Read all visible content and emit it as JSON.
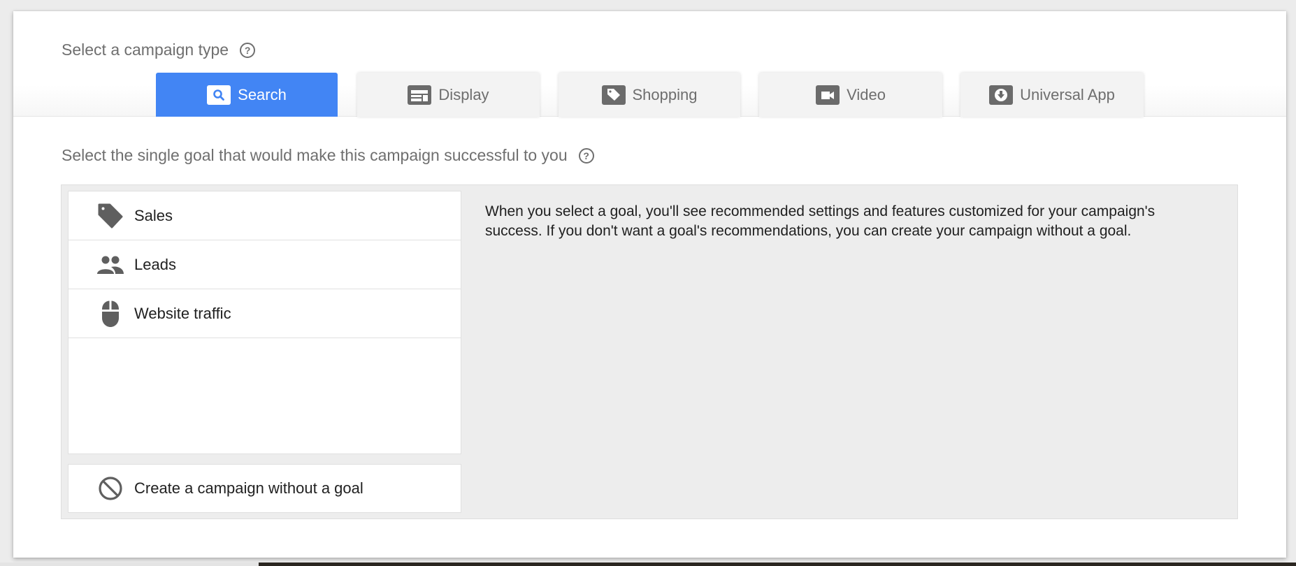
{
  "campaign_type": {
    "title": "Select a campaign type",
    "help_icon": "help-circle-icon",
    "tabs": [
      {
        "label": "Search",
        "icon": "search-icon",
        "active": true
      },
      {
        "label": "Display",
        "icon": "display-layout-icon",
        "active": false
      },
      {
        "label": "Shopping",
        "icon": "tag-icon",
        "active": false
      },
      {
        "label": "Video",
        "icon": "video-camera-icon",
        "active": false
      },
      {
        "label": "Universal App",
        "icon": "download-icon",
        "active": false
      }
    ],
    "active_color": "#4285f4"
  },
  "goal": {
    "title": "Select the single goal that would make this campaign successful to you",
    "help_icon": "help-circle-icon",
    "options": [
      {
        "label": "Sales",
        "icon": "tag-icon"
      },
      {
        "label": "Leads",
        "icon": "people-icon"
      },
      {
        "label": "Website traffic",
        "icon": "mouse-icon"
      }
    ],
    "no_goal": {
      "label": "Create a campaign without a goal",
      "icon": "block-icon"
    },
    "description": "When you select a goal, you'll see recommended settings and features customized for your campaign's success. If you don't want a goal's recommendations, you can create your campaign without a goal."
  }
}
